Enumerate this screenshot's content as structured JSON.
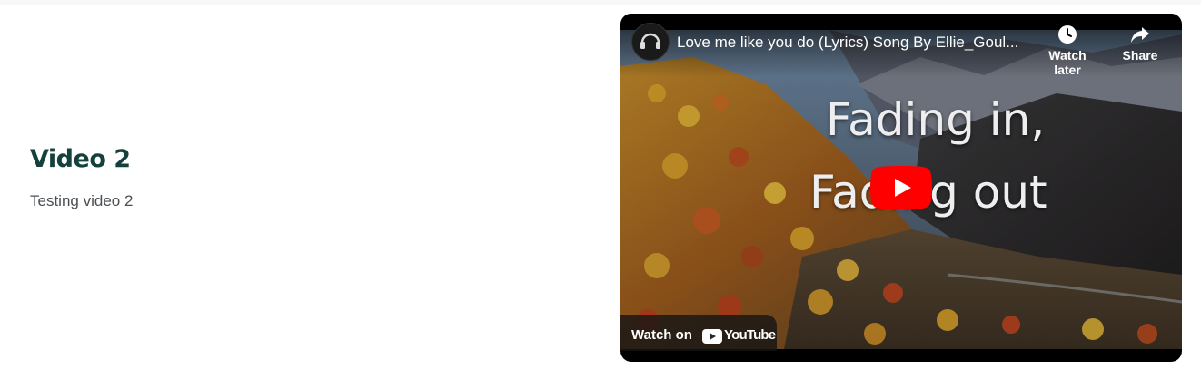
{
  "section": {
    "title": "Video 2",
    "description": "Testing video 2"
  },
  "video": {
    "title": "Love me like you do (Lyrics) Song By Ellie_Goul...",
    "lyrics_line_1": "Fading in,",
    "lyrics_line_2": "Fading out",
    "watch_later_label": "Watch later",
    "share_label": "Share",
    "watch_on_label": "Watch on",
    "youtube_label": "YouTube",
    "colors": {
      "play_button": "#ff0000",
      "title_text": "#14413c"
    }
  }
}
